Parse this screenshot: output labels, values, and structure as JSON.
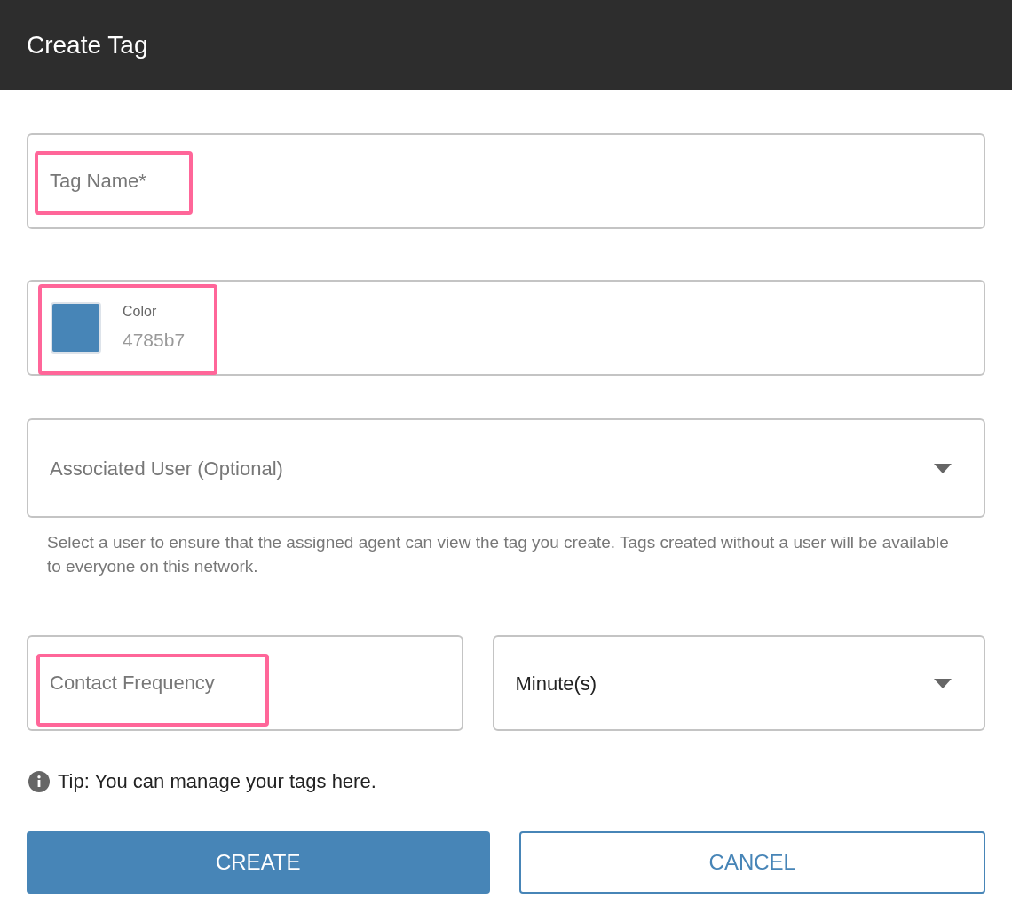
{
  "window": {
    "title": "Create Tag"
  },
  "tag_name": {
    "placeholder": "Tag Name*",
    "highlighted": true
  },
  "color_field": {
    "label": "Color",
    "value": "4785b7",
    "color": "#4785b7",
    "highlighted": true
  },
  "associated_user": {
    "placeholder": "Associated User (Optional)",
    "helper": "Select a user to ensure that the assigned agent can view the tag you create. Tags created without a user will be available to everyone on this network."
  },
  "contact_frequency": {
    "placeholder": "Contact Frequency",
    "highlighted": true
  },
  "unit": {
    "value": "Minute(s)"
  },
  "tip": {
    "text": "Tip: You can manage your tags ",
    "link": "here",
    "end": "."
  },
  "buttons": [
    {
      "label": "CREATE",
      "kind": "primary"
    },
    {
      "label": "CANCEL",
      "kind": "secondary"
    }
  ]
}
